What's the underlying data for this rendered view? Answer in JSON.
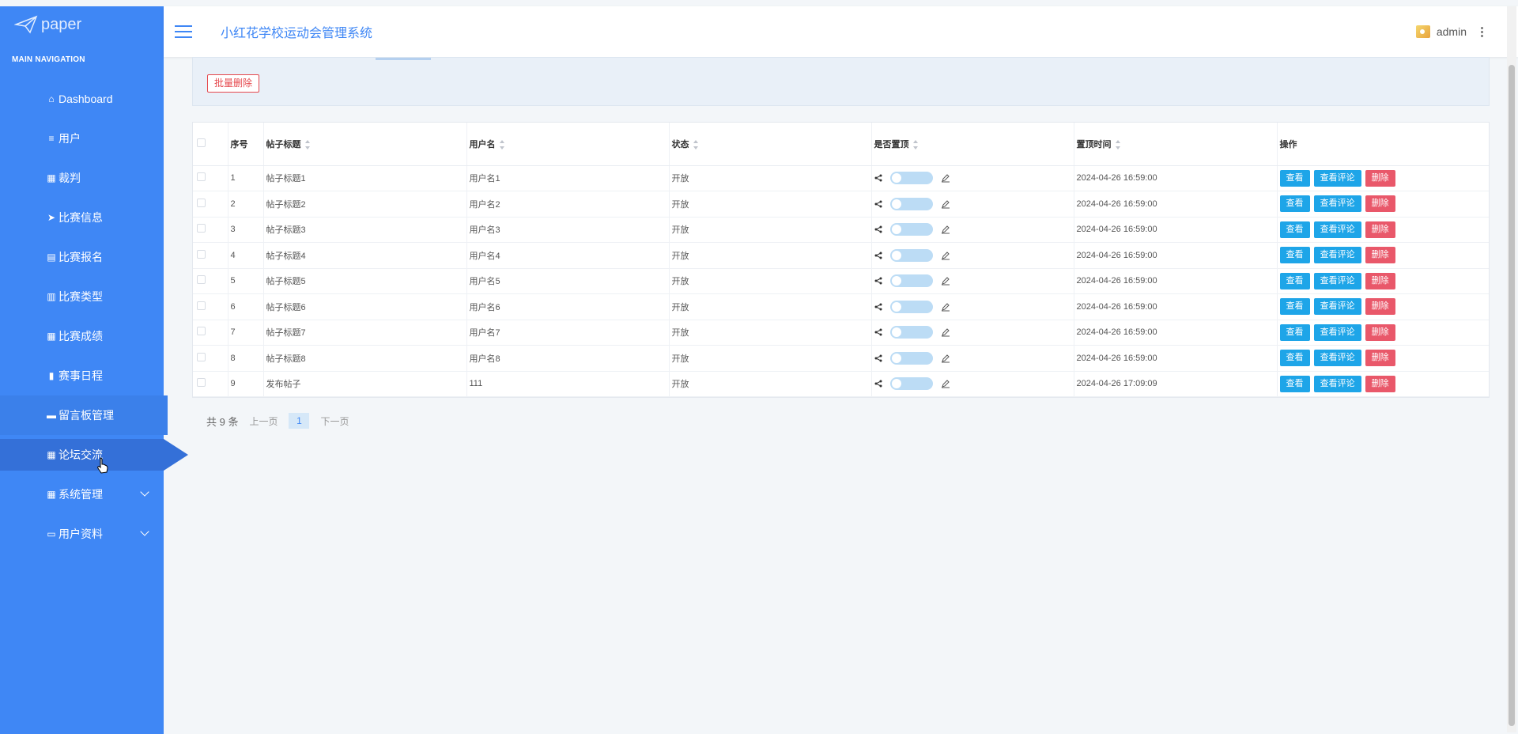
{
  "brand": {
    "logo_text": "paper"
  },
  "header": {
    "title": "小红花学校运动会管理系统",
    "user": "admin"
  },
  "sidebar": {
    "heading": "MAIN NAVIGATION",
    "items": [
      {
        "label": "Dashboard",
        "icon": "home-icon"
      },
      {
        "label": "用户",
        "icon": "list-icon"
      },
      {
        "label": "裁判",
        "icon": "grid-icon"
      },
      {
        "label": "比赛信息",
        "icon": "send-icon"
      },
      {
        "label": "比赛报名",
        "icon": "clipboard-icon"
      },
      {
        "label": "比赛类型",
        "icon": "book-icon"
      },
      {
        "label": "比赛成绩",
        "icon": "grid-icon"
      },
      {
        "label": "赛事日程",
        "icon": "bar-chart-icon"
      },
      {
        "label": "留言板管理",
        "icon": "message-icon"
      },
      {
        "label": "论坛交流",
        "icon": "grid-icon"
      },
      {
        "label": "系统管理",
        "icon": "grid-icon"
      },
      {
        "label": "用户资料",
        "icon": "card-icon"
      }
    ],
    "active": "论坛交流"
  },
  "toolbar": {
    "batch_delete": "批量删除"
  },
  "table": {
    "columns": [
      "序号",
      "帖子标题",
      "用户名",
      "状态",
      "是否置顶",
      "置顶时间",
      "操作"
    ],
    "rows": [
      {
        "no": "1",
        "title": "帖子标题1",
        "user": "用户名1",
        "status": "开放",
        "time": "2024-04-26 16:59:00"
      },
      {
        "no": "2",
        "title": "帖子标题2",
        "user": "用户名2",
        "status": "开放",
        "time": "2024-04-26 16:59:00"
      },
      {
        "no": "3",
        "title": "帖子标题3",
        "user": "用户名3",
        "status": "开放",
        "time": "2024-04-26 16:59:00"
      },
      {
        "no": "4",
        "title": "帖子标题4",
        "user": "用户名4",
        "status": "开放",
        "time": "2024-04-26 16:59:00"
      },
      {
        "no": "5",
        "title": "帖子标题5",
        "user": "用户名5",
        "status": "开放",
        "time": "2024-04-26 16:59:00"
      },
      {
        "no": "6",
        "title": "帖子标题6",
        "user": "用户名6",
        "status": "开放",
        "time": "2024-04-26 16:59:00"
      },
      {
        "no": "7",
        "title": "帖子标题7",
        "user": "用户名7",
        "status": "开放",
        "time": "2024-04-26 16:59:00"
      },
      {
        "no": "8",
        "title": "帖子标题8",
        "user": "用户名8",
        "status": "开放",
        "time": "2024-04-26 16:59:00"
      },
      {
        "no": "9",
        "title": "发布帖子",
        "user": "111",
        "status": "开放",
        "time": "2024-04-26 17:09:09"
      }
    ],
    "actions": {
      "view": "查看",
      "comments": "查看评论",
      "delete": "删除"
    }
  },
  "pagination": {
    "total": "共 9 条",
    "prev": "上一页",
    "current": "1",
    "next": "下一页"
  },
  "colors": {
    "primary": "#3f87f5",
    "info": "#1ea5e8",
    "danger": "#e9586a"
  }
}
